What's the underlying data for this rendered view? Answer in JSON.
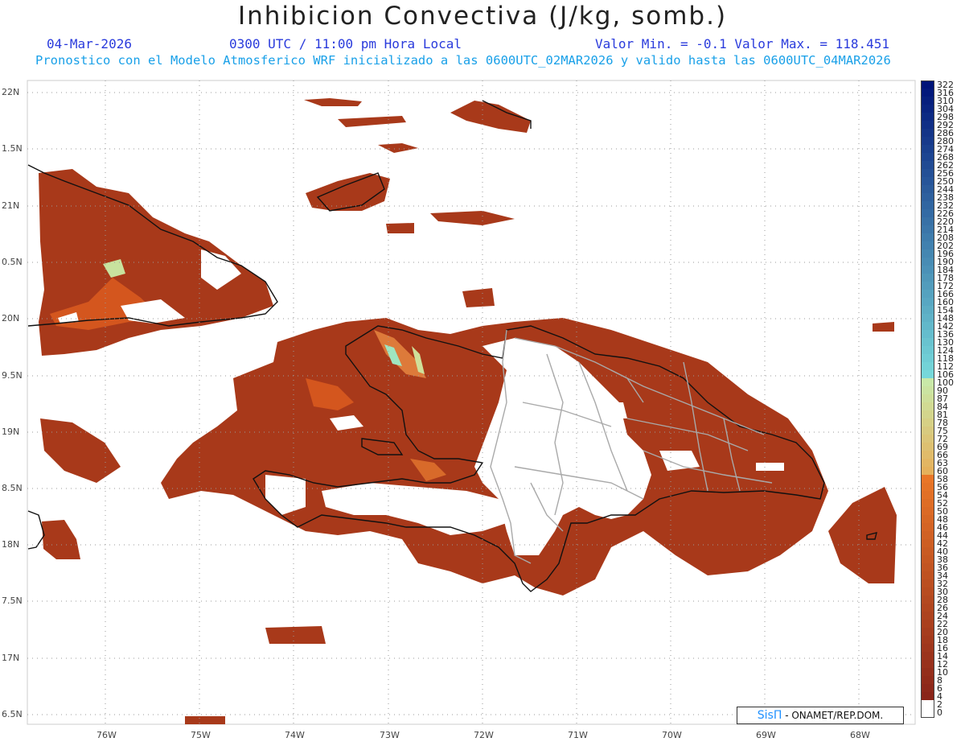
{
  "header": {
    "title": "Inhibicion Convectiva (J/kg, somb.)",
    "date": "04-Mar-2026",
    "time": "0300 UTC / 11:00 pm Hora Local",
    "min_max": "Valor Min. = -0.1  Valor Max. = 118.451",
    "model_info": "Pronostico con el Modelo Atmosferico WRF inicializado a las 0600UTC_02MAR2026 y valido hasta las  0600UTC_04MAR2026"
  },
  "colors": {
    "title": "#222222",
    "date_text": "#2a3bdc",
    "info_text": "#19a0e8",
    "cin_main": "#a8391a",
    "cin_dark": "#8f2e18",
    "cin_light": "#d4561e",
    "cin_high": "#9fe5c0",
    "border": "#111111",
    "provinces": "#a9a9a9",
    "grid": "#9a9a9a"
  },
  "map": {
    "lat_labels": [
      "22N",
      "1.5N",
      "21N",
      "0.5N",
      "20N",
      "9.5N",
      "19N",
      "8.5N",
      "18N",
      "7.5N",
      "17N",
      "6.5N"
    ],
    "lon_labels": [
      "76W",
      "75W",
      "74W",
      "73W",
      "72W",
      "71W",
      "70W",
      "69W",
      "68W"
    ]
  },
  "legend": {
    "labels": [
      "322",
      "316",
      "310",
      "304",
      "298",
      "292",
      "286",
      "280",
      "274",
      "268",
      "262",
      "256",
      "250",
      "244",
      "238",
      "232",
      "226",
      "220",
      "214",
      "208",
      "202",
      "196",
      "190",
      "184",
      "178",
      "172",
      "166",
      "160",
      "154",
      "148",
      "142",
      "136",
      "130",
      "124",
      "118",
      "112",
      "106",
      "100",
      "90",
      "87",
      "84",
      "81",
      "78",
      "75",
      "72",
      "69",
      "66",
      "63",
      "60",
      "58",
      "56",
      "54",
      "52",
      "50",
      "48",
      "46",
      "44",
      "42",
      "40",
      "38",
      "36",
      "34",
      "32",
      "30",
      "28",
      "26",
      "24",
      "22",
      "20",
      "18",
      "16",
      "14",
      "12",
      "10",
      "8",
      "6",
      "4",
      "2",
      "0"
    ]
  },
  "credit": {
    "logo": "SisΠ",
    "text": " - ONAMET/REP.DOM."
  }
}
